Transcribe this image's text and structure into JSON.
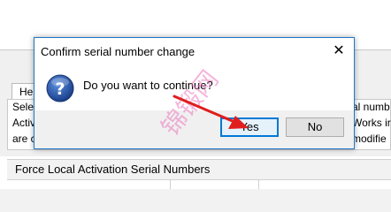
{
  "background_window": {
    "tab_label": "Hel",
    "left_lines": [
      "Sele",
      "Activ",
      "are c"
    ],
    "right_lines": [
      "al numb",
      "Works ir",
      "modifie"
    ],
    "section_header": "Force Local Activation Serial Numbers"
  },
  "dialog": {
    "title": "Confirm serial number change",
    "close_glyph": "✕",
    "message": "Do you want to continue?",
    "yes_label": "Yes",
    "no_label": "No",
    "icon": "question-icon"
  },
  "watermark": {
    "text": "锦锻网"
  },
  "colors": {
    "accent_border": "#1e78c8",
    "icon_blue": "#1a4f9c",
    "arrow_red": "#e01e1e",
    "watermark_pink": "#eb78be"
  }
}
